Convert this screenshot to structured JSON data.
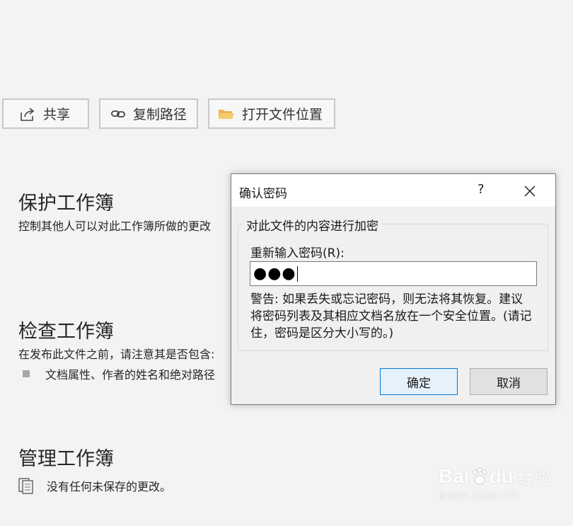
{
  "toolbar": {
    "share_label": "共享",
    "copy_path_label": "复制路径",
    "open_location_label": "打开文件位置"
  },
  "protect": {
    "title": "保护工作簿",
    "desc": "控制其他人可以对此工作簿所做的更改"
  },
  "inspect": {
    "title": "检查工作簿",
    "desc": "在发布此文件之前，请注意其是否包含:",
    "items": [
      "文档属性、作者的姓名和绝对路径"
    ]
  },
  "manage": {
    "title": "管理工作簿",
    "status": "没有任何未保存的更改。"
  },
  "dialog": {
    "title": "确认密码",
    "help": "?",
    "group_label": "对此文件的内容进行加密",
    "field_label": "重新输入密码(R):",
    "password_mask": "●●●",
    "warning": "警告: 如果丢失或忘记密码，则无法将其恢复。建议将密码列表及其相应文档名放在一个安全位置。(请记住，密码是区分大小写的。)",
    "ok_label": "确定",
    "cancel_label": "取消"
  },
  "watermark": {
    "brand": "Bai",
    "brand2": "du",
    "product": "经验",
    "url": "jingyan.baidu.com"
  },
  "colors": {
    "background": "#f3f3f3",
    "dialog_bg": "#f0f0f0",
    "ok_border": "#0078d7",
    "ok_bg": "#e5f1fb",
    "folder": "#e8b658"
  }
}
